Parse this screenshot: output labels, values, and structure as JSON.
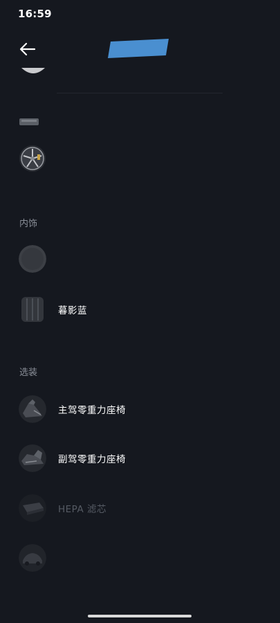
{
  "status_bar": {
    "time": "16:59"
  },
  "header": {
    "back_icon": "arrow-left-icon",
    "title_redacted_color": "#4a8fd0"
  },
  "sections": {
    "interior": {
      "label": "内饰"
    },
    "options": {
      "label": "选装"
    }
  },
  "items": [
    {
      "name": "",
      "icon": "partial-wheel-thumb"
    },
    {
      "name": "",
      "icon": "small-car-part-thumb"
    },
    {
      "name": "",
      "icon": "wheel-rim-thumb"
    },
    {
      "name": "",
      "icon": "dark-fabric-thumb"
    },
    {
      "name": "暮影蓝",
      "icon": "seat-panel-thumb"
    },
    {
      "name": "主驾零重力座椅",
      "icon": "driver-seat-thumb"
    },
    {
      "name": "副驾零重力座椅",
      "icon": "passenger-seat-thumb"
    },
    {
      "name": "HEPA 滤芯",
      "icon": "hepa-filter-thumb"
    },
    {
      "name": "",
      "icon": "car-accessory-thumb"
    }
  ],
  "colors": {
    "background": "#15181f",
    "text": "#ffffff",
    "section_label": "#8a8f98"
  }
}
